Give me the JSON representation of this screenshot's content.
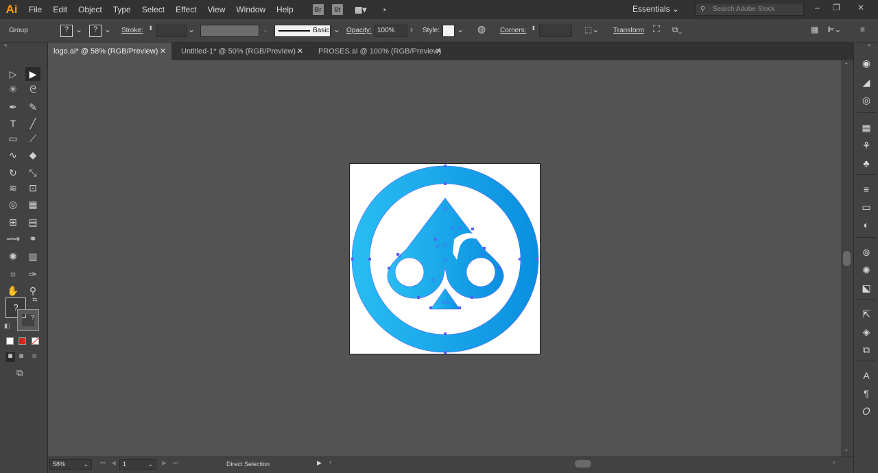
{
  "app": {
    "logo": "Ai"
  },
  "menu": [
    "File",
    "Edit",
    "Object",
    "Type",
    "Select",
    "Effect",
    "View",
    "Window",
    "Help"
  ],
  "bridge_buttons": [
    "Br",
    "St"
  ],
  "workspace": "Essentials",
  "search": {
    "placeholder": "Search Adobe Stock"
  },
  "window_controls": [
    "–",
    "❐",
    "✕"
  ],
  "control_bar": {
    "selection_type": "Group",
    "fill_label": "?",
    "stroke_swatch_label": "?",
    "stroke_label": "Stroke:",
    "brush_label": "Basic",
    "opacity_label": "Opacity:",
    "opacity_value": "100%",
    "style_label": "Style:",
    "corners_label": "Corners:",
    "transform_label": "Transform"
  },
  "tabs": [
    {
      "label": "logo.ai* @ 58% (RGB/Preview)",
      "active": true
    },
    {
      "label": "Untitled-1* @ 50% (RGB/Preview)",
      "active": false
    },
    {
      "label": "PROSES.ai @ 100% (RGB/Preview)",
      "active": false
    }
  ],
  "tools": [
    {
      "name": "selection-tool-icon",
      "glyph": "▷"
    },
    {
      "name": "direct-selection-tool-icon",
      "glyph": "▶",
      "selected": true
    },
    {
      "name": "magic-wand-tool-icon",
      "glyph": "✳"
    },
    {
      "name": "lasso-tool-icon",
      "glyph": "ᘓ"
    },
    {
      "name": "pen-tool-icon",
      "glyph": "✒"
    },
    {
      "name": "curvature-tool-icon",
      "glyph": "✎"
    },
    {
      "name": "type-tool-icon",
      "glyph": "T"
    },
    {
      "name": "line-tool-icon",
      "glyph": "╱"
    },
    {
      "name": "rectangle-tool-icon",
      "glyph": "▭"
    },
    {
      "name": "paintbrush-tool-icon",
      "glyph": "⟋"
    },
    {
      "name": "shaper-tool-icon",
      "glyph": "∿"
    },
    {
      "name": "eraser-tool-icon",
      "glyph": "◆"
    },
    {
      "name": "rotate-tool-icon",
      "glyph": "↻"
    },
    {
      "name": "scale-tool-icon",
      "glyph": "⤡"
    },
    {
      "name": "width-tool-icon",
      "glyph": "≋"
    },
    {
      "name": "free-transform-tool-icon",
      "glyph": "⊡"
    },
    {
      "name": "shape-builder-tool-icon",
      "glyph": "◎"
    },
    {
      "name": "perspective-grid-tool-icon",
      "glyph": "▦"
    },
    {
      "name": "mesh-tool-icon",
      "glyph": "⊞"
    },
    {
      "name": "gradient-tool-icon",
      "glyph": "▤"
    },
    {
      "name": "eyedropper-tool-icon",
      "glyph": "⟿"
    },
    {
      "name": "blend-tool-icon",
      "glyph": "⚭"
    },
    {
      "name": "symbol-sprayer-tool-icon",
      "glyph": "✺"
    },
    {
      "name": "column-graph-tool-icon",
      "glyph": "▥"
    },
    {
      "name": "artboard-tool-icon",
      "glyph": "⌗"
    },
    {
      "name": "slice-tool-icon",
      "glyph": "✑"
    },
    {
      "name": "hand-tool-icon",
      "glyph": "✋"
    },
    {
      "name": "zoom-tool-icon",
      "glyph": "⚲"
    }
  ],
  "fill_stroke": {
    "fill_label": "?",
    "stroke_label": "?"
  },
  "right_panel_icons": [
    "color-icon",
    "color-guide-icon",
    "appearance-icon",
    "swatches-icon",
    "brushes-icon",
    "symbols-icon",
    "stroke-icon",
    "gradient-icon",
    "transparency-icon",
    "libraries-icon",
    "graphic-styles-icon",
    "asset-export-icon",
    "export-icon",
    "layers-icon",
    "artboards-icon",
    "character-icon",
    "paragraph-icon",
    "opentype-icon"
  ],
  "status": {
    "zoom": "58%",
    "artboard_number": "1",
    "tool_name": "Direct Selection"
  },
  "colors": {
    "accent": "#1aa3e8",
    "logo_light": "#29bdf2",
    "logo_dark": "#0a8fe0",
    "anchor": "#5560ff"
  }
}
